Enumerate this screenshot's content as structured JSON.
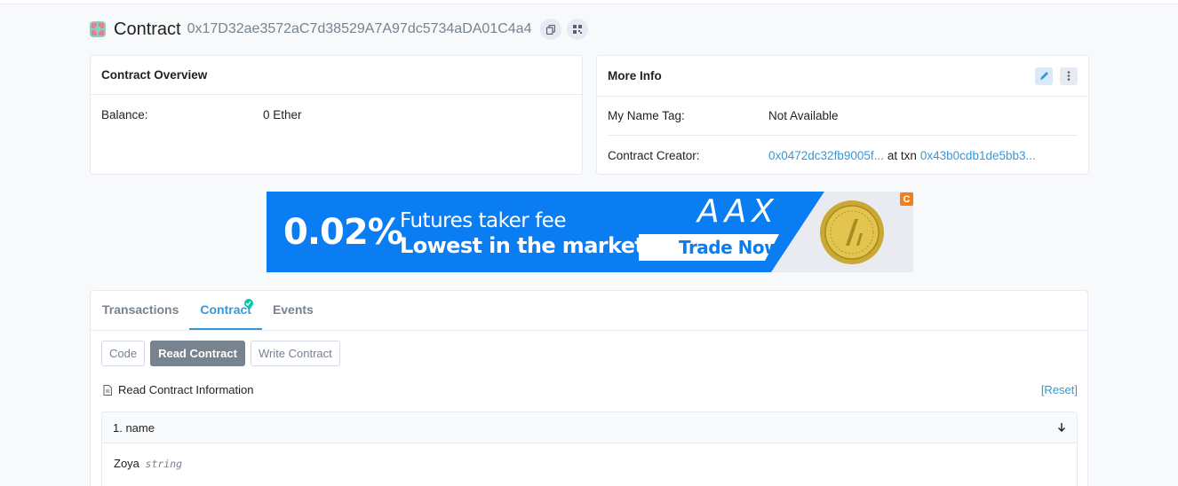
{
  "header": {
    "title": "Contract",
    "address": "0x17D32ae3572aC7d38529A7A97dc5734aDA01C4a4"
  },
  "overview": {
    "title": "Contract Overview",
    "balance_label": "Balance:",
    "balance_value": "0 Ether"
  },
  "more_info": {
    "title": "More Info",
    "name_tag_label": "My Name Tag:",
    "name_tag_value": "Not Available",
    "creator_label": "Contract Creator:",
    "creator_address": "0x0472dc32fb9005f...",
    "creator_at_txn": "at txn",
    "creator_txn": "0x43b0cdb1de5bb3..."
  },
  "ad": {
    "percent": "0.02%",
    "line1": "Futures taker fee",
    "line2": "Lowest in the market",
    "brand": "AAX",
    "cta": "Trade Now",
    "badge": "C"
  },
  "tabs": {
    "items": [
      "Transactions",
      "Contract",
      "Events"
    ],
    "active": "Contract"
  },
  "subtabs": {
    "code": "Code",
    "read": "Read Contract",
    "write": "Write Contract"
  },
  "read_contract": {
    "info_label": "Read Contract Information",
    "reset": "[Reset]",
    "function_title": "1. name",
    "result_value": "Zoya",
    "result_type": "string"
  },
  "colors": {
    "accent": "#3498db",
    "verified": "#00c9a7",
    "ad_blue": "#0a7df2",
    "muted": "#77838f"
  },
  "icons": [
    "contract-icon",
    "copy-icon",
    "qr-code-icon",
    "edit-icon",
    "more-icon",
    "check-icon",
    "document-icon",
    "arrow-down-icon"
  ]
}
